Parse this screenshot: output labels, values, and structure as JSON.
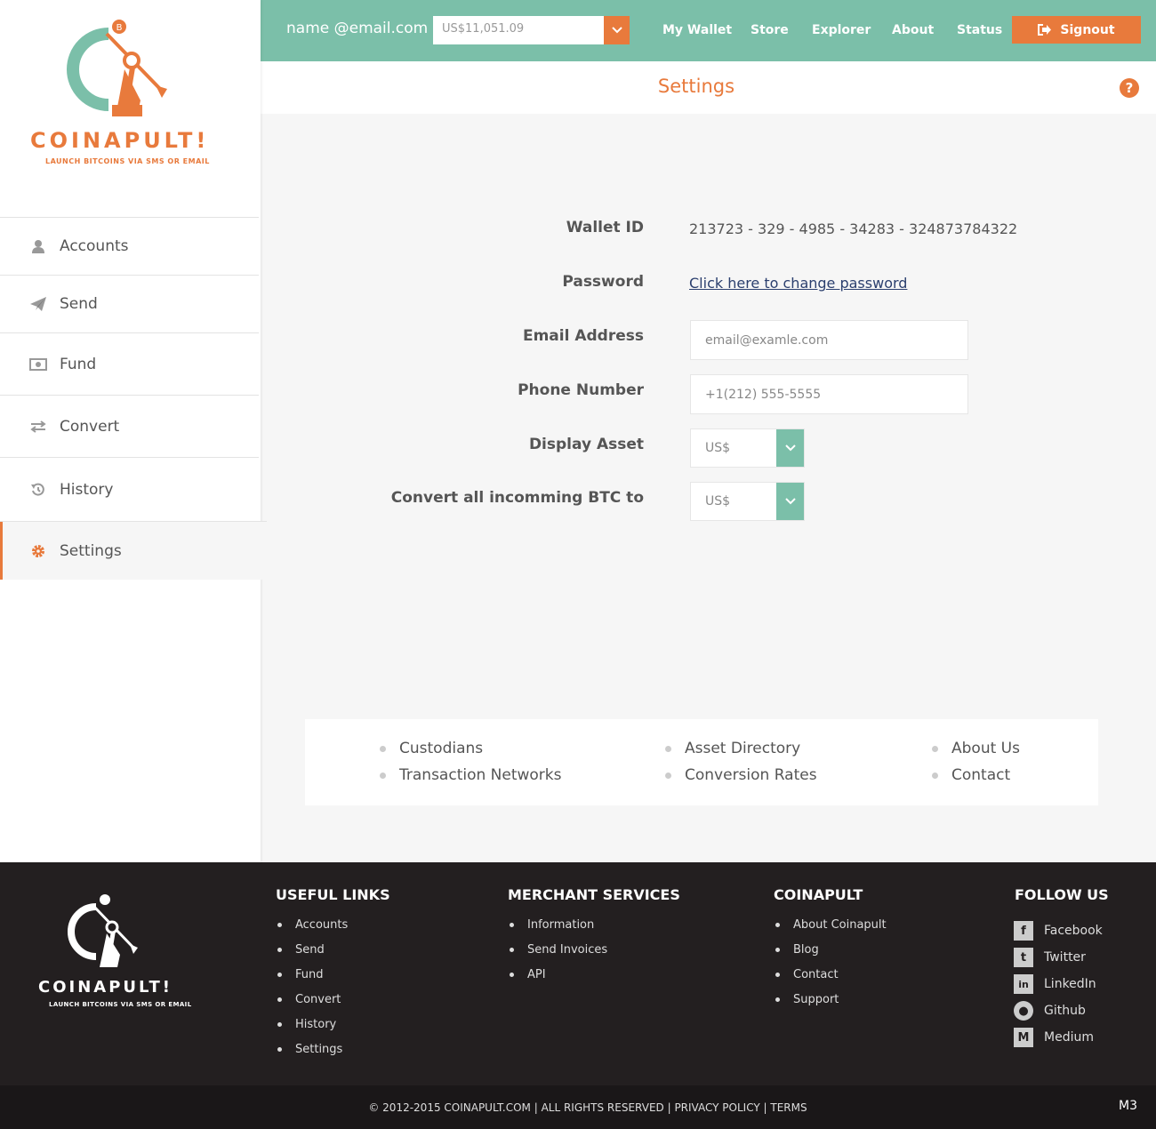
{
  "brand": {
    "wordmark": "COINAPULT!",
    "tagline": "LAUNCH BITCOINS VIA SMS OR EMAIL",
    "accent": "#e87a3c",
    "teal": "#7bbfa9"
  },
  "sidebar": {
    "items": [
      {
        "label": "Accounts",
        "icon": "user-icon"
      },
      {
        "label": "Send",
        "icon": "paper-plane-icon"
      },
      {
        "label": "Fund",
        "icon": "money-icon"
      },
      {
        "label": "Convert",
        "icon": "exchange-icon"
      },
      {
        "label": "History",
        "icon": "history-icon"
      },
      {
        "label": "Settings",
        "icon": "gear-icon",
        "active": true
      }
    ]
  },
  "topbar": {
    "email": "name @email.com",
    "balance": "US$11,051.09",
    "nav": [
      "My Wallet",
      "Store",
      "Explorer",
      "About",
      "Status"
    ],
    "signout": "Signout"
  },
  "page": {
    "title": "Settings"
  },
  "settings": {
    "wallet_id_label": "Wallet ID",
    "wallet_id": "213723 - 329 - 4985 - 34283 - 324873784322",
    "password_label": "Password",
    "password_link": "Click here to change password",
    "email_label": "Email Address",
    "email_placeholder": "email@examle.com",
    "phone_label": "Phone Number",
    "phone_placeholder": "+1(212) 555-5555",
    "display_asset_label": "Display Asset",
    "display_asset_value": "US$",
    "convert_label": "Convert all incomming BTC to",
    "convert_value": "US$"
  },
  "links_card": {
    "col1": [
      "Custodians",
      "Transaction Networks"
    ],
    "col2": [
      "Asset Directory",
      "Conversion Rates"
    ],
    "col3": [
      "About Us",
      "Contact"
    ]
  },
  "footer": {
    "useful_links_title": "USEFUL LINKS",
    "useful_links": [
      "Accounts",
      "Send",
      "Fund",
      "Convert",
      "History",
      "Settings"
    ],
    "merchant_title": "MERCHANT SERVICES",
    "merchant_links": [
      "Information",
      "Send Invoices",
      "API"
    ],
    "coinapult_title": "COINAPULT",
    "coinapult_links": [
      "About Coinapult",
      "Blog",
      "Contact",
      "Support"
    ],
    "follow_title": "FOLLOW US",
    "social": [
      {
        "label": "Facebook",
        "icon": "facebook-icon",
        "glyph": "f"
      },
      {
        "label": "Twitter",
        "icon": "twitter-icon",
        "glyph": "t"
      },
      {
        "label": "LinkedIn",
        "icon": "linkedin-icon",
        "glyph": "in"
      },
      {
        "label": "Github",
        "icon": "github-icon",
        "glyph": "●"
      },
      {
        "label": "Medium",
        "icon": "medium-icon",
        "glyph": "M"
      }
    ],
    "copyright": "© 2012-2015 COINAPULT.COM",
    "rights": "ALL RIGHTS RESERVED",
    "privacy": "PRIVACY POLICY",
    "terms": "TERMS",
    "version": "M3"
  }
}
